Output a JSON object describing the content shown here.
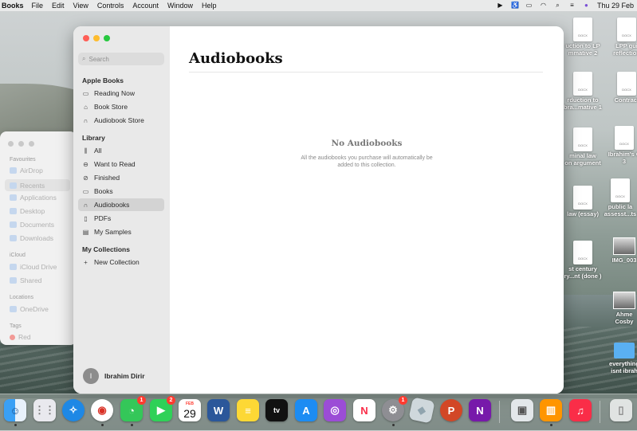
{
  "menubar": {
    "app": "Books",
    "menus": [
      "File",
      "Edit",
      "View",
      "Controls",
      "Account",
      "Window",
      "Help"
    ],
    "clock": "Thu 29 Feb"
  },
  "finder": {
    "favourites_label": "Favourites",
    "favourites": [
      "AirDrop",
      "Recents",
      "Applications",
      "Desktop",
      "Documents",
      "Downloads"
    ],
    "icloud_label": "iCloud",
    "icloud": [
      "iCloud Drive",
      "Shared"
    ],
    "locations_label": "Locations",
    "locations": [
      "OneDrive"
    ],
    "tags_label": "Tags",
    "tags": [
      "Red"
    ]
  },
  "books": {
    "search_placeholder": "Search",
    "sections": {
      "apple_books": "Apple Books",
      "library": "Library",
      "my_collections": "My Collections"
    },
    "apple_books_items": [
      "Reading Now",
      "Book Store",
      "Audiobook Store"
    ],
    "library_items": [
      "All",
      "Want to Read",
      "Finished",
      "Books",
      "Audiobooks",
      "PDFs",
      "My Samples"
    ],
    "selected_item": "Audiobooks",
    "new_collection": "New Collection",
    "user_initial": "I",
    "user_name": "Ibrahim Dirir",
    "page_title": "Audiobooks",
    "empty_title": "No Audiobooks",
    "empty_subtitle": "All the audiobooks you purchase will automatically be added to this collection."
  },
  "desktop_icons": [
    "uction to LP\nmmative 2",
    "LPP gui\nreflection",
    "rduction to\nbra...mative 1",
    "Contract",
    "minal law\non argument",
    "Ibrahim's C\n3",
    "law (essay)",
    "public la\nassesst...ts",
    "IMG_003",
    "st century\nry...nt (done )",
    "Ahme\nCosby",
    "everything\nisnt ibrah"
  ],
  "dock": {
    "calendar_month": "FEB",
    "calendar_day": "29",
    "badges": {
      "messages": "1",
      "facetime": "2",
      "settings": "1"
    },
    "tv_label": "tv"
  },
  "colors": {
    "selection": "#d3d3d3",
    "close": "#ff5f57",
    "minimize": "#febc2e",
    "zoom": "#28c840"
  }
}
